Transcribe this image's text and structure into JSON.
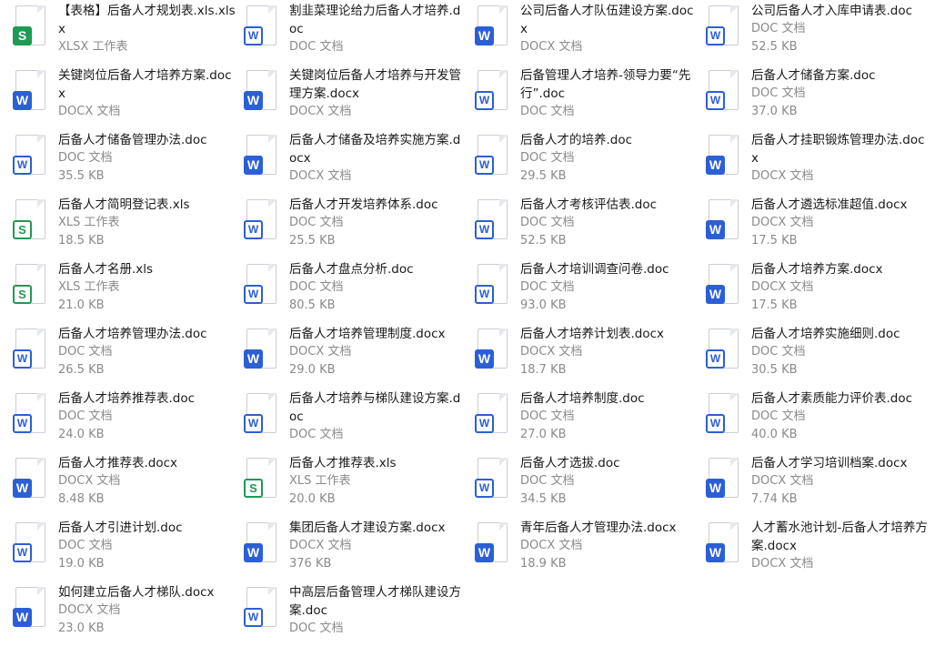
{
  "files": [
    {
      "name": "【表格】后备人才规划表.xls.xlsx",
      "type": "XLSX 工作表",
      "size": "",
      "icon": "s-solid"
    },
    {
      "name": "割韭菜理论给力后备人才培养.doc",
      "type": "DOC 文档",
      "size": "",
      "icon": "w-outline"
    },
    {
      "name": "公司后备人才队伍建设方案.docx",
      "type": "DOCX 文档",
      "size": "",
      "icon": "w-solid"
    },
    {
      "name": "公司后备人才入库申请表.doc",
      "type": "DOC 文档",
      "size": "52.5 KB",
      "icon": "w-outline"
    },
    {
      "name": "关键岗位后备人才培养方案.docx",
      "type": "DOCX 文档",
      "size": "",
      "icon": "w-solid"
    },
    {
      "name": "关键岗位后备人才培养与开发管理方案.docx",
      "type": "DOCX 文档",
      "size": "",
      "icon": "w-solid"
    },
    {
      "name": "后备管理人才培养-领导力要“先行”.doc",
      "type": "DOC 文档",
      "size": "",
      "icon": "w-outline"
    },
    {
      "name": "后备人才储备方案.doc",
      "type": "DOC 文档",
      "size": "37.0 KB",
      "icon": "w-outline"
    },
    {
      "name": "后备人才储备管理办法.doc",
      "type": "DOC 文档",
      "size": "35.5 KB",
      "icon": "w-outline"
    },
    {
      "name": "后备人才储备及培养实施方案.docx",
      "type": "DOCX 文档",
      "size": "",
      "icon": "w-solid"
    },
    {
      "name": "后备人才的培养.doc",
      "type": "DOC 文档",
      "size": "29.5 KB",
      "icon": "w-outline"
    },
    {
      "name": "后备人才挂职锻炼管理办法.docx",
      "type": "DOCX 文档",
      "size": "",
      "icon": "w-solid"
    },
    {
      "name": "后备人才简明登记表.xls",
      "type": "XLS 工作表",
      "size": "18.5 KB",
      "icon": "s-outline"
    },
    {
      "name": "后备人才开发培养体系.doc",
      "type": "DOC 文档",
      "size": "25.5 KB",
      "icon": "w-outline"
    },
    {
      "name": "后备人才考核评估表.doc",
      "type": "DOC 文档",
      "size": "52.5 KB",
      "icon": "w-outline"
    },
    {
      "name": "后备人才遴选标准超值.docx",
      "type": "DOCX 文档",
      "size": "17.5 KB",
      "icon": "w-solid"
    },
    {
      "name": "后备人才名册.xls",
      "type": "XLS 工作表",
      "size": "21.0 KB",
      "icon": "s-outline"
    },
    {
      "name": "后备人才盘点分析.doc",
      "type": "DOC 文档",
      "size": "80.5 KB",
      "icon": "w-outline"
    },
    {
      "name": "后备人才培训调查问卷.doc",
      "type": "DOC 文档",
      "size": "93.0 KB",
      "icon": "w-outline"
    },
    {
      "name": "后备人才培养方案.docx",
      "type": "DOCX 文档",
      "size": "17.5 KB",
      "icon": "w-solid"
    },
    {
      "name": "后备人才培养管理办法.doc",
      "type": "DOC 文档",
      "size": "26.5 KB",
      "icon": "w-outline"
    },
    {
      "name": "后备人才培养管理制度.docx",
      "type": "DOCX 文档",
      "size": "29.0 KB",
      "icon": "w-solid"
    },
    {
      "name": "后备人才培养计划表.docx",
      "type": "DOCX 文档",
      "size": "18.7 KB",
      "icon": "w-solid"
    },
    {
      "name": "后备人才培养实施细则.doc",
      "type": "DOC 文档",
      "size": "30.5 KB",
      "icon": "w-outline"
    },
    {
      "name": "后备人才培养推荐表.doc",
      "type": "DOC 文档",
      "size": "24.0 KB",
      "icon": "w-outline"
    },
    {
      "name": "后备人才培养与梯队建设方案.doc",
      "type": "DOC 文档",
      "size": "",
      "icon": "w-outline"
    },
    {
      "name": "后备人才培养制度.doc",
      "type": "DOC 文档",
      "size": "27.0 KB",
      "icon": "w-outline"
    },
    {
      "name": "后备人才素质能力评价表.doc",
      "type": "DOC 文档",
      "size": "40.0 KB",
      "icon": "w-outline"
    },
    {
      "name": "后备人才推荐表.docx",
      "type": "DOCX 文档",
      "size": "8.48 KB",
      "icon": "w-solid"
    },
    {
      "name": "后备人才推荐表.xls",
      "type": "XLS 工作表",
      "size": "20.0 KB",
      "icon": "s-outline"
    },
    {
      "name": "后备人才选拔.doc",
      "type": "DOC 文档",
      "size": "34.5 KB",
      "icon": "w-outline"
    },
    {
      "name": "后备人才学习培训档案.docx",
      "type": "DOCX 文档",
      "size": "7.74 KB",
      "icon": "w-solid"
    },
    {
      "name": "后备人才引进计划.doc",
      "type": "DOC 文档",
      "size": "19.0 KB",
      "icon": "w-outline"
    },
    {
      "name": "集团后备人才建设方案.docx",
      "type": "DOCX 文档",
      "size": "376 KB",
      "icon": "w-solid"
    },
    {
      "name": "青年后备人才管理办法.docx",
      "type": "DOCX 文档",
      "size": "18.9 KB",
      "icon": "w-solid"
    },
    {
      "name": "人才蓄水池计划-后备人才培养方案.docx",
      "type": "DOCX 文档",
      "size": "",
      "icon": "w-solid"
    },
    {
      "name": "如何建立后备人才梯队.docx",
      "type": "DOCX 文档",
      "size": "23.0 KB",
      "icon": "w-solid"
    },
    {
      "name": "中高层后备管理人才梯队建设方案.doc",
      "type": "DOC 文档",
      "size": "",
      "icon": "w-outline"
    }
  ],
  "badges": {
    "word": "W",
    "sheet": "S"
  },
  "colors": {
    "word_blue": "#2c5fd6",
    "sheet_green": "#1f9a54",
    "meta_gray": "#8a8a8a"
  }
}
